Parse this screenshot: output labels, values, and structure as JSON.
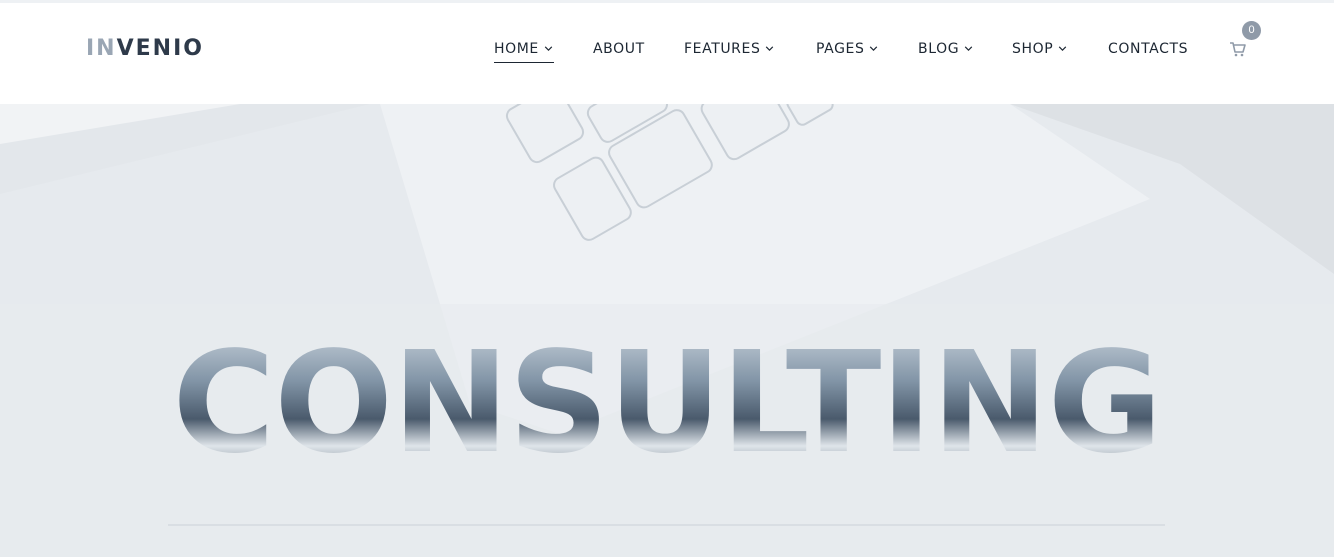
{
  "logo": {
    "part1": "IN",
    "part2": "VENIO"
  },
  "nav": {
    "items": [
      {
        "label": "HOME",
        "has_dropdown": true,
        "active": true
      },
      {
        "label": "ABOUT",
        "has_dropdown": false
      },
      {
        "label": "FEATURES",
        "has_dropdown": true
      },
      {
        "label": "PAGES",
        "has_dropdown": true
      },
      {
        "label": "BLOG",
        "has_dropdown": true
      },
      {
        "label": "SHOP",
        "has_dropdown": true
      },
      {
        "label": "CONTACTS",
        "has_dropdown": false
      }
    ]
  },
  "cart": {
    "icon": "cart-icon",
    "count": "0"
  },
  "hero": {
    "headline": "CONSULTING",
    "background": "keyboard-photo"
  },
  "colors": {
    "brand_dark": "#2e3a4a",
    "brand_light": "#9aa6b4",
    "nav_text": "#1d2733",
    "badge": "#8f9aa8",
    "hero_bg": "#e6eaee"
  }
}
